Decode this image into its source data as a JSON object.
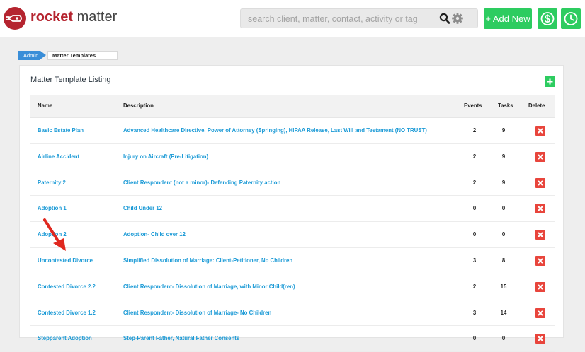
{
  "brand": {
    "name_bold": "rocket",
    "name_rest": " matter"
  },
  "search": {
    "placeholder": "search client, matter, contact, activity or tag"
  },
  "header": {
    "add_new_label": "+ Add New"
  },
  "breadcrumb": {
    "root": "Admin",
    "current": "Matter Templates"
  },
  "panel": {
    "title": "Matter Template Listing"
  },
  "table": {
    "headers": {
      "name": "Name",
      "description": "Description",
      "events": "Events",
      "tasks": "Tasks",
      "delete": "Delete"
    },
    "rows": [
      {
        "name": "Basic Estate Plan",
        "description": "Advanced Healthcare Directive, Power of Attorney (Springing), HIPAA Release, Last Will and Testament (NO TRUST)",
        "events": "2",
        "tasks": "9"
      },
      {
        "name": "Airline Accident",
        "description": "Injury on Aircraft (Pre-Litigation)",
        "events": "2",
        "tasks": "9"
      },
      {
        "name": "Paternity 2",
        "description": "Client Respondent (not a minor)- Defending Paternity action",
        "events": "2",
        "tasks": "9"
      },
      {
        "name": "Adoption 1",
        "description": "Child Under 12",
        "events": "0",
        "tasks": "0"
      },
      {
        "name": "Adoption 2",
        "description": "Adoption- Child over 12",
        "events": "0",
        "tasks": "0"
      },
      {
        "name": "Uncontested Divorce",
        "description": "Simplified Dissolution of Marriage: Client-Petitioner, No Children",
        "events": "3",
        "tasks": "8"
      },
      {
        "name": "Contested Divorce 2.2",
        "description": "Client Respondent- Dissolution of Marriage, with Minor Child(ren)",
        "events": "2",
        "tasks": "15"
      },
      {
        "name": "Contested Divorce 1.2",
        "description": "Client Respondent- Dissolution of Marriage- No Children",
        "events": "3",
        "tasks": "14"
      },
      {
        "name": "Stepparent Adoption",
        "description": "Step-Parent Father, Natural Father Consents",
        "events": "0",
        "tasks": "0"
      }
    ]
  },
  "colors": {
    "accent_green": "#2dcc60",
    "link_blue": "#1b9ad6",
    "delete_red": "#e8453c",
    "brand_red": "#b5242f",
    "crumb_blue": "#3a8ed8"
  },
  "icons": [
    "rocket-logo-icon",
    "search-icon",
    "gear-icon",
    "dollar-icon",
    "clock-icon",
    "plus-icon",
    "delete-x-icon",
    "annotation-arrow"
  ]
}
